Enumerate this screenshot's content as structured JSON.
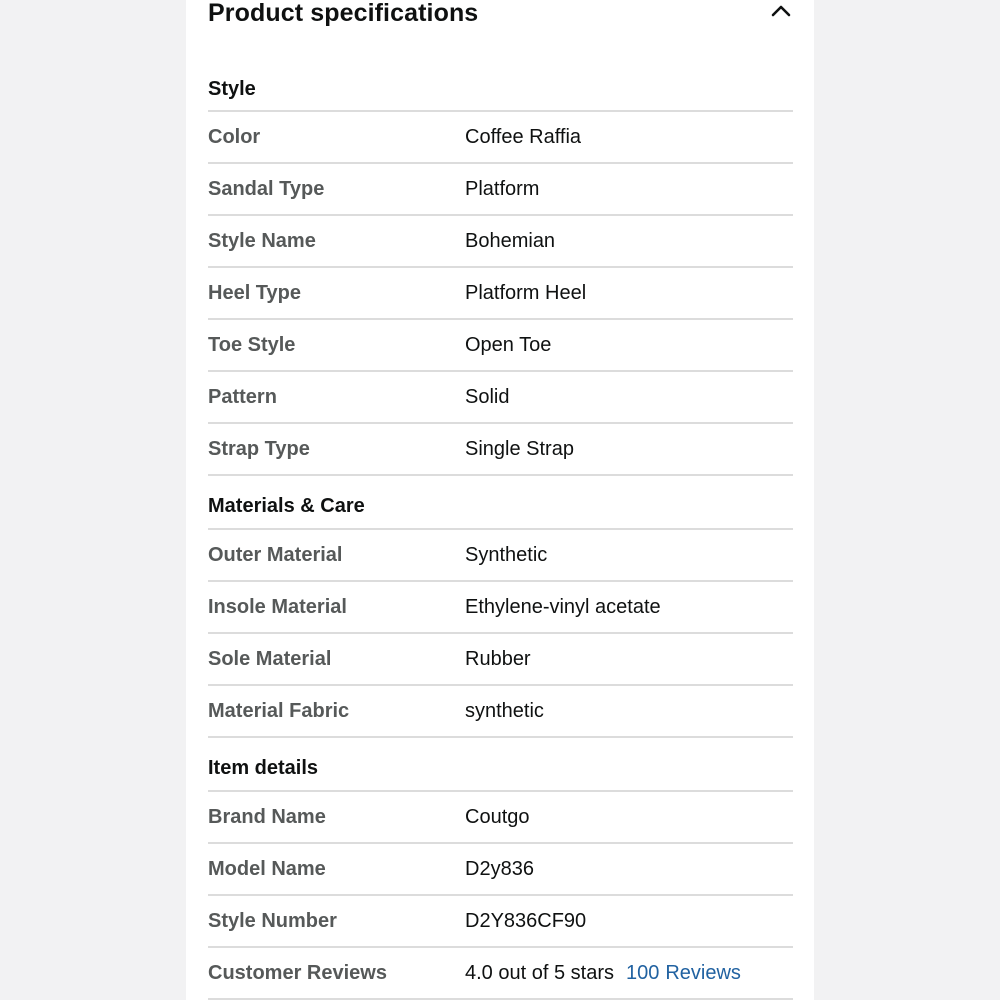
{
  "header": {
    "title": "Product specifications",
    "toggle_icon": "chevron-up-icon"
  },
  "sections": {
    "style": {
      "heading": "Style",
      "rows": [
        {
          "label": "Color",
          "value": "Coffee Raffia"
        },
        {
          "label": "Sandal Type",
          "value": "Platform"
        },
        {
          "label": "Style Name",
          "value": "Bohemian"
        },
        {
          "label": "Heel Type",
          "value": "Platform Heel"
        },
        {
          "label": "Toe Style",
          "value": "Open Toe"
        },
        {
          "label": "Pattern",
          "value": "Solid"
        },
        {
          "label": "Strap Type",
          "value": "Single Strap"
        }
      ]
    },
    "materials": {
      "heading": "Materials & Care",
      "rows": [
        {
          "label": "Outer Material",
          "value": "Synthetic"
        },
        {
          "label": "Insole Material",
          "value": "Ethylene-vinyl acetate"
        },
        {
          "label": "Sole Material",
          "value": "Rubber"
        },
        {
          "label": "Material Fabric",
          "value": "synthetic"
        }
      ]
    },
    "item_details": {
      "heading": "Item details",
      "rows": [
        {
          "label": "Brand Name",
          "value": "Coutgo"
        },
        {
          "label": "Model Name",
          "value": "D2y836"
        },
        {
          "label": "Style Number",
          "value": "D2Y836CF90"
        }
      ],
      "reviews": {
        "label": "Customer Reviews",
        "rating_text": "4.0 out of 5 stars",
        "rating": 4.0,
        "rating_max": 5,
        "count": "100",
        "count_label": "Reviews"
      }
    }
  },
  "colors": {
    "text": "#0f1111",
    "label": "#565959",
    "link": "#2162a1",
    "divider": "#dcdcdc"
  }
}
